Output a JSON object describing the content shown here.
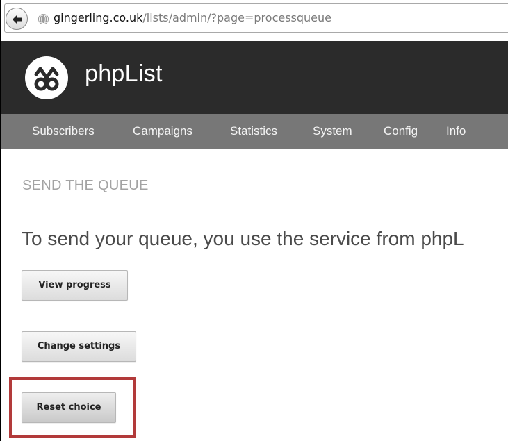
{
  "browser": {
    "url_host": "gingerling.co.uk",
    "url_path": "/lists/admin/?page=processqueue"
  },
  "header": {
    "brand": "phpList"
  },
  "nav": {
    "items": [
      {
        "label": "Subscribers"
      },
      {
        "label": "Campaigns"
      },
      {
        "label": "Statistics"
      },
      {
        "label": "System"
      },
      {
        "label": "Config"
      },
      {
        "label": "Info"
      }
    ]
  },
  "main": {
    "title": "SEND THE QUEUE",
    "intro": "To send your queue, you use the service from phpL",
    "buttons": {
      "view_progress": "View progress",
      "change_settings": "Change settings",
      "reset_choice": "Reset choice"
    }
  },
  "colors": {
    "header_bg": "#2b2b2b",
    "nav_bg": "#777777",
    "highlight": "#b23a3a"
  }
}
